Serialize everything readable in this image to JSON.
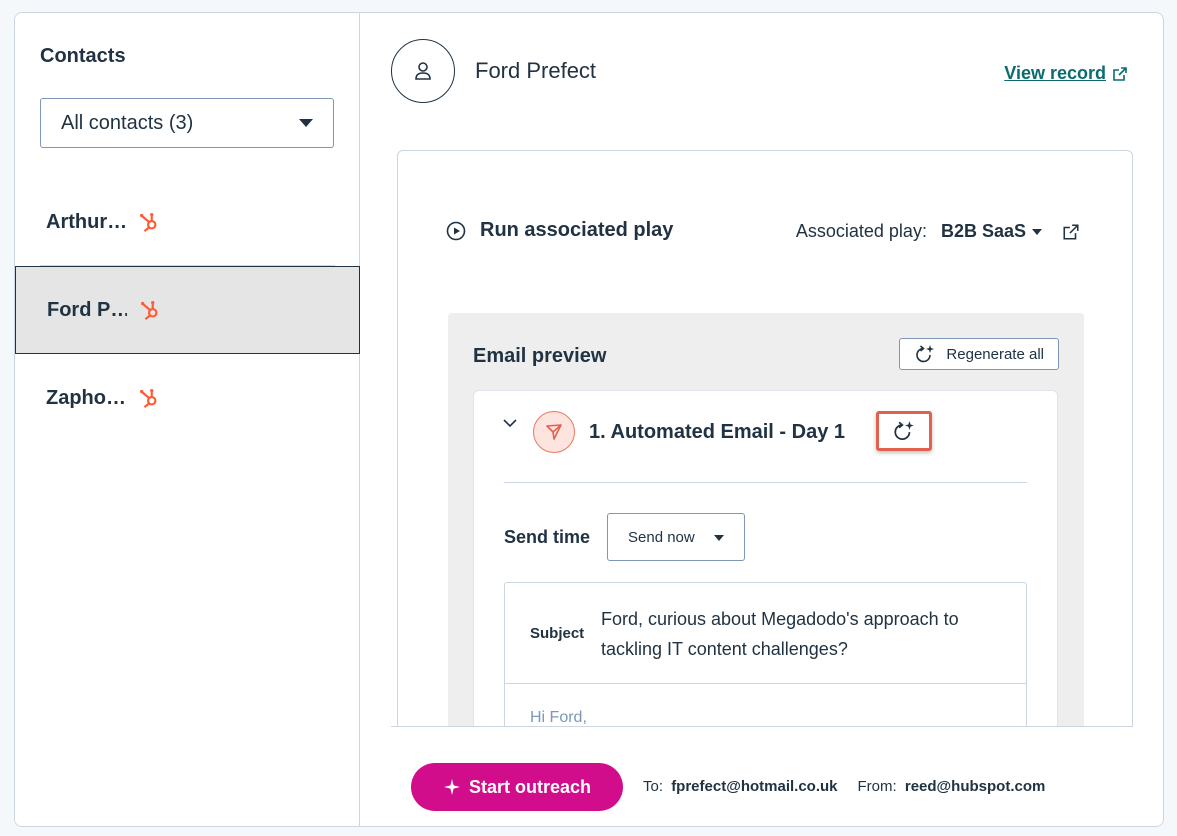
{
  "sidebar": {
    "title": "Contacts",
    "filter": {
      "selected": "All contacts (3)"
    },
    "contacts": [
      {
        "name": "Arthur…",
        "active": false
      },
      {
        "name": "Ford P…",
        "active": true
      },
      {
        "name": "Zapho…",
        "active": false
      }
    ]
  },
  "header": {
    "contact_name": "Ford Prefect",
    "view_record_label": "View record"
  },
  "play": {
    "run_label": "Run associated play",
    "associated_label": "Associated play:",
    "associated_value": "B2B SaaS"
  },
  "preview": {
    "title": "Email preview",
    "regenerate_all_label": "Regenerate all",
    "email": {
      "title": "1. Automated Email - Day 1",
      "send_time_label": "Send time",
      "send_time_value": "Send now",
      "subject_label": "Subject",
      "subject_text": "Ford, curious about Megadodo's approach to tackling IT content challenges?",
      "body_preview": "Hi Ford,"
    }
  },
  "footer": {
    "start_label": "Start outreach",
    "to_label": "To:",
    "to_value": "fprefect@hotmail.co.uk",
    "from_label": "From:",
    "from_value": "reed@hubspot.com"
  },
  "colors": {
    "accent_pink": "#d10d8c",
    "link_teal": "#0b6b6e",
    "hubspot_orange": "#ff5c35",
    "highlight_red": "#e0614f"
  }
}
